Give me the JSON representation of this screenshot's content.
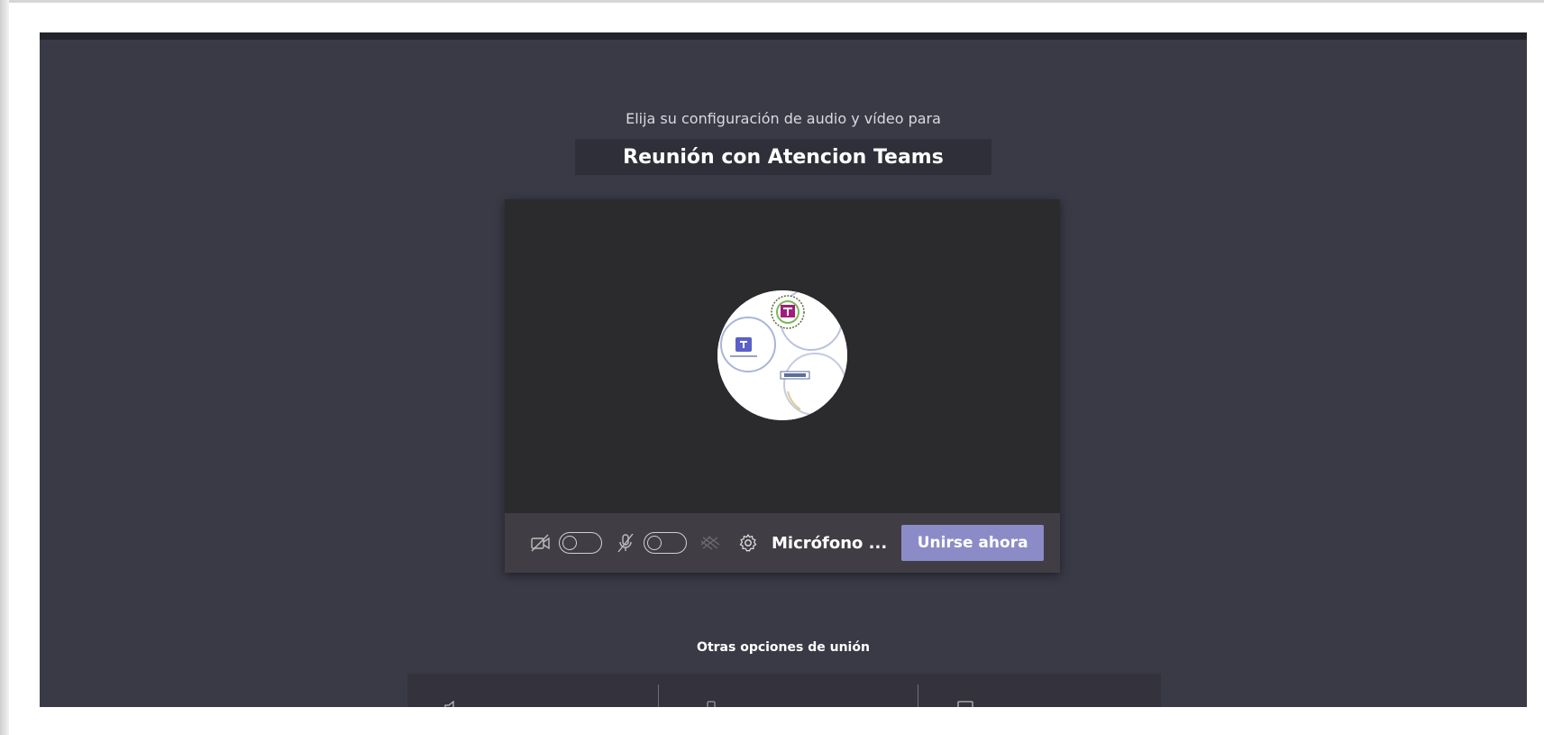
{
  "join_prompt": "Elija su configuración de audio y vídeo para",
  "meeting": {
    "title": "Reunión con Atencion Teams"
  },
  "controls": {
    "camera_icon": "camera-off-icon",
    "mic_icon": "mic-off-icon",
    "blur_icon": "background-blur-icon",
    "settings_icon": "gear-icon",
    "device_label": "Micrófono ...",
    "join_label": "Unirse ahora"
  },
  "other_options": {
    "title": "Otras opciones de unión"
  },
  "colors": {
    "background": "#3a3a47",
    "preview": "#2b2a2c",
    "control_bar": "#403e44",
    "accent": "#8b8cc7"
  }
}
